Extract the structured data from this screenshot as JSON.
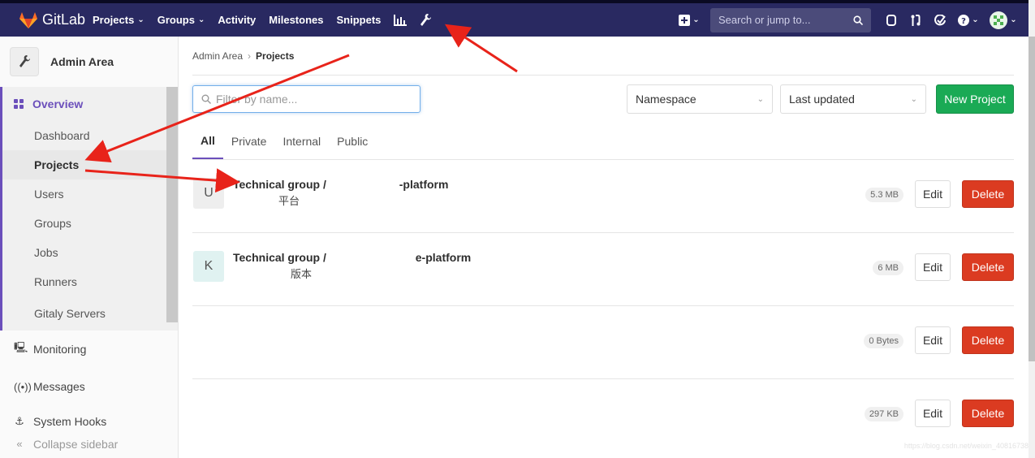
{
  "topbar": {
    "logo_text": "GitLab",
    "nav": [
      {
        "label": "Projects",
        "chevron": true
      },
      {
        "label": "Groups",
        "chevron": true
      },
      {
        "label": "Activity",
        "chevron": false
      },
      {
        "label": "Milestones",
        "chevron": false
      },
      {
        "label": "Snippets",
        "chevron": false
      }
    ],
    "search_placeholder": "Search or jump to...",
    "colors": {
      "bg": "#292961",
      "accent": "#fc6d26"
    }
  },
  "sidebar": {
    "title": "Admin Area",
    "section": "Overview",
    "sub_items": [
      "Dashboard",
      "Projects",
      "Users",
      "Groups",
      "Jobs",
      "Runners",
      "Gitaly Servers"
    ],
    "active_sub": "Projects",
    "main_items": [
      {
        "label": "Monitoring",
        "icon": "monitor-icon"
      },
      {
        "label": "Messages",
        "icon": "broadcast-icon"
      },
      {
        "label": "System Hooks",
        "icon": "hook-icon"
      }
    ],
    "collapse_label": "Collapse sidebar"
  },
  "breadcrumb": {
    "parent": "Admin Area",
    "current": "Projects"
  },
  "filters": {
    "placeholder": "Filter by name...",
    "namespace": "Namespace",
    "sort": "Last updated",
    "new_button": "New Project"
  },
  "tabs": [
    "All",
    "Private",
    "Internal",
    "Public"
  ],
  "projects": [
    {
      "avatar": "U",
      "name_left": "Technical group / ",
      "name_right": "-platform",
      "desc": "平台",
      "size": "5.3 MB"
    },
    {
      "avatar": "K",
      "name_left": "Technical group / ",
      "name_right": "e-platform",
      "desc": "版本",
      "size": "6 MB"
    },
    {
      "avatar": "",
      "name_left": "",
      "name_right": "",
      "desc": "",
      "size": "0 Bytes"
    },
    {
      "avatar": "",
      "name_left": "",
      "name_right": "",
      "desc": "",
      "size": "297 KB"
    }
  ],
  "actions": {
    "edit": "Edit",
    "delete": "Delete"
  },
  "watermark": "https://blog.csdn.net/weixin_40816738"
}
